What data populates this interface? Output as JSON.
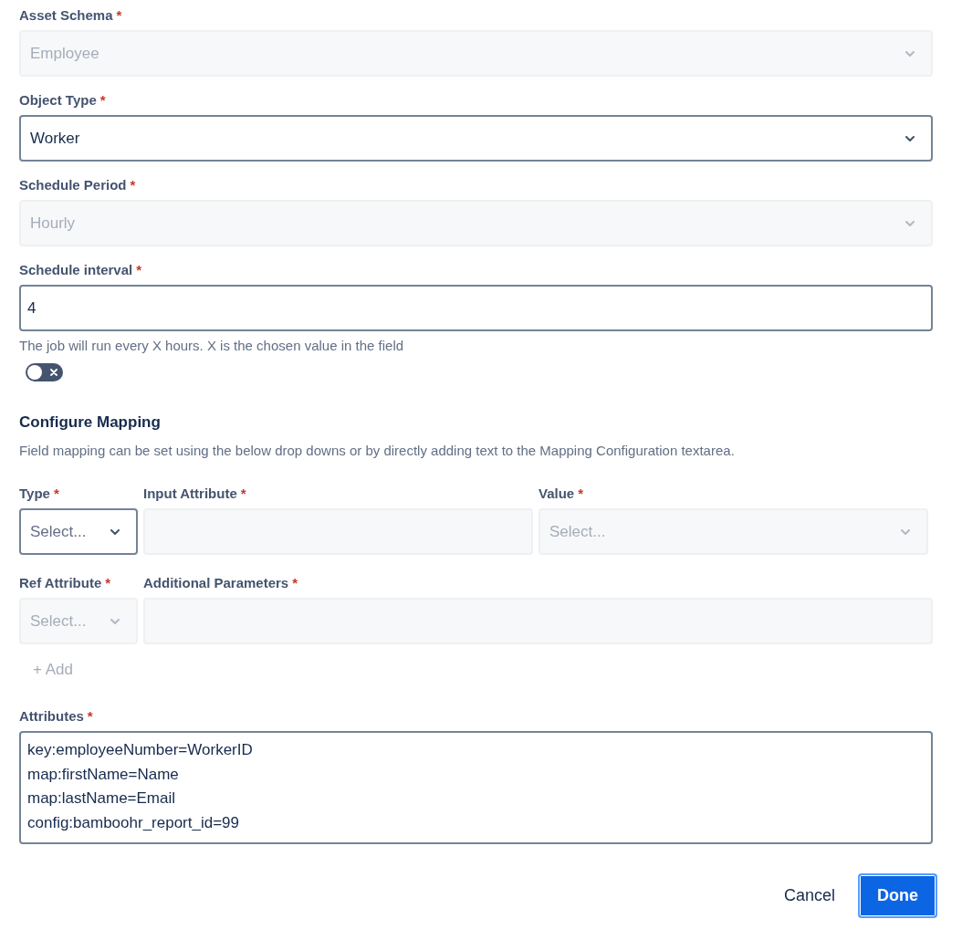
{
  "fields": [
    {
      "kind": "select",
      "label": "Asset Schema",
      "required_mark": "*",
      "value": "Employee",
      "disabled": true
    },
    {
      "kind": "select",
      "label": "Object Type",
      "required_mark": "*",
      "value": "Worker",
      "disabled": false
    },
    {
      "kind": "select",
      "label": "Schedule Period",
      "required_mark": "*",
      "value": "Hourly",
      "disabled": true
    },
    {
      "kind": "text",
      "label": "Schedule interval",
      "required_mark": "*",
      "value": "4",
      "disabled": false,
      "help": "The job will run every X hours. X is the chosen value in the field"
    }
  ],
  "toggle": {
    "on": false
  },
  "mapping": {
    "title": "Configure Mapping",
    "description": "Field mapping can be set using the below drop downs or by directly adding text to the Mapping Configuration textarea.",
    "rows": [
      [
        {
          "kind": "select",
          "label": "Type",
          "required_mark": "*",
          "placeholder": "Select...",
          "disabled": false
        },
        {
          "kind": "text",
          "label": "Input Attribute",
          "required_mark": "*",
          "disabled": true
        },
        {
          "kind": "select",
          "label": "Value",
          "required_mark": "*",
          "placeholder": "Select...",
          "disabled": true
        }
      ],
      [
        {
          "kind": "select",
          "label": "Ref Attribute",
          "required_mark": "*",
          "placeholder": "Select...",
          "disabled": true
        },
        {
          "kind": "text",
          "label": "Additional Parameters",
          "required_mark": "*",
          "disabled": true
        }
      ]
    ],
    "add_button": {
      "label": "+ Add",
      "disabled": true
    }
  },
  "attributes": {
    "label": "Attributes",
    "required_mark": "*",
    "lines": [
      "key:employeeNumber=WorkerID",
      "map:firstName=Name",
      "map:lastName=Email",
      "config:bamboohr_report_id=99"
    ]
  },
  "buttons": [
    {
      "label": "Cancel",
      "kind": "subtle",
      "focused": false
    },
    {
      "label": "Done",
      "kind": "primary",
      "focused": true
    }
  ]
}
